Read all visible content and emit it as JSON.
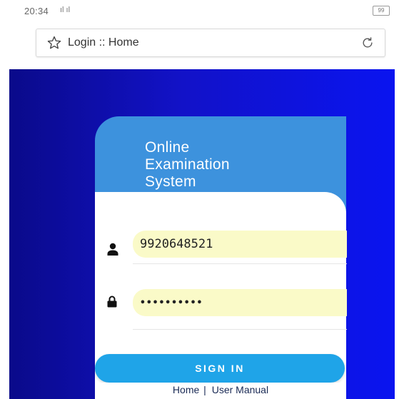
{
  "status_bar": {
    "time": "20:34",
    "signal_text": "ّّıl ☰",
    "battery": "99"
  },
  "browser": {
    "tab_title": "Login :: Home",
    "star_icon": "star-outline-icon",
    "reload_icon": "reload-icon"
  },
  "header": {
    "line1": "Online",
    "line2": "Examination",
    "line3": "System"
  },
  "form": {
    "username_value": "9920648521",
    "password_value": "••••••••••",
    "user_icon": "user-icon",
    "lock_icon": "lock-icon"
  },
  "actions": {
    "signin_label": "SIGN IN"
  },
  "footer_links": {
    "home": "Home",
    "separator": "|",
    "manual": "User Manual"
  },
  "colors": {
    "gradient_left": "#0a0a8a",
    "gradient_right": "#0a14f0",
    "header_card": "#3d92dd",
    "input_bg": "#fafac8",
    "signin_button": "#1fa4e8"
  }
}
